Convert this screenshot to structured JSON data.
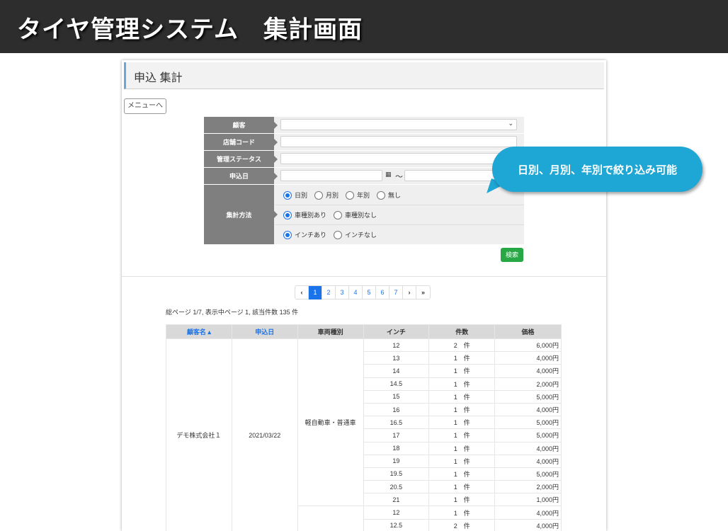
{
  "header": {
    "title": "タイヤ管理システム　集計画面"
  },
  "panel": {
    "title": "申込 集計",
    "menu_button": "メニューへ"
  },
  "form": {
    "labels": {
      "customer": "顧客",
      "store_code": "店舗コード",
      "status": "管理ステータス",
      "date": "申込日",
      "method": "集計方法"
    },
    "date_separator": "～",
    "aggregation": {
      "options": [
        "日別",
        "月別",
        "年別",
        "無し"
      ],
      "selected": "日別"
    },
    "vehicle": {
      "options": [
        "車種別あり",
        "車種別なし"
      ],
      "selected": "車種別あり"
    },
    "inch": {
      "options": [
        "インチあり",
        "インチなし"
      ],
      "selected": "インチあり"
    },
    "search_button": "検索"
  },
  "pagination": {
    "prev": "‹",
    "pages": [
      "1",
      "2",
      "3",
      "4",
      "5",
      "6",
      "7"
    ],
    "current": "1",
    "next": "›",
    "last": "»"
  },
  "summary": "総ページ 1/7, 表示中ページ 1, 該当件数 135 件",
  "table": {
    "headers": [
      "顧客名 ▴",
      "申込日",
      "車両種別",
      "インチ",
      "件数",
      "価格"
    ],
    "customer": "デモ株式会社１",
    "date": "2021/03/22",
    "vehicle_group": "軽自動車・普通車",
    "rows": [
      {
        "inch": "12",
        "count": "2　件",
        "price": "6,000円"
      },
      {
        "inch": "13",
        "count": "1　件",
        "price": "4,000円"
      },
      {
        "inch": "14",
        "count": "1　件",
        "price": "4,000円"
      },
      {
        "inch": "14.5",
        "count": "1　件",
        "price": "2,000円"
      },
      {
        "inch": "15",
        "count": "1　件",
        "price": "5,000円"
      },
      {
        "inch": "16",
        "count": "1　件",
        "price": "4,000円"
      },
      {
        "inch": "16.5",
        "count": "1　件",
        "price": "5,000円"
      },
      {
        "inch": "17",
        "count": "1　件",
        "price": "5,000円"
      },
      {
        "inch": "18",
        "count": "1　件",
        "price": "4,000円"
      },
      {
        "inch": "19",
        "count": "1　件",
        "price": "4,000円"
      },
      {
        "inch": "19.5",
        "count": "1　件",
        "price": "5,000円"
      },
      {
        "inch": "20.5",
        "count": "1　件",
        "price": "2,000円"
      },
      {
        "inch": "21",
        "count": "1　件",
        "price": "1,000円"
      },
      {
        "inch": "12",
        "count": "1　件",
        "price": "4,000円"
      },
      {
        "inch": "12.5",
        "count": "2　件",
        "price": "4,000円"
      }
    ]
  },
  "callout": "日別、月別、年別で絞り込み可能",
  "colors": {
    "accent": "#1a73e8",
    "callout": "#1ea6d4",
    "search": "#28a745",
    "topbar": "#2d2d2d"
  }
}
